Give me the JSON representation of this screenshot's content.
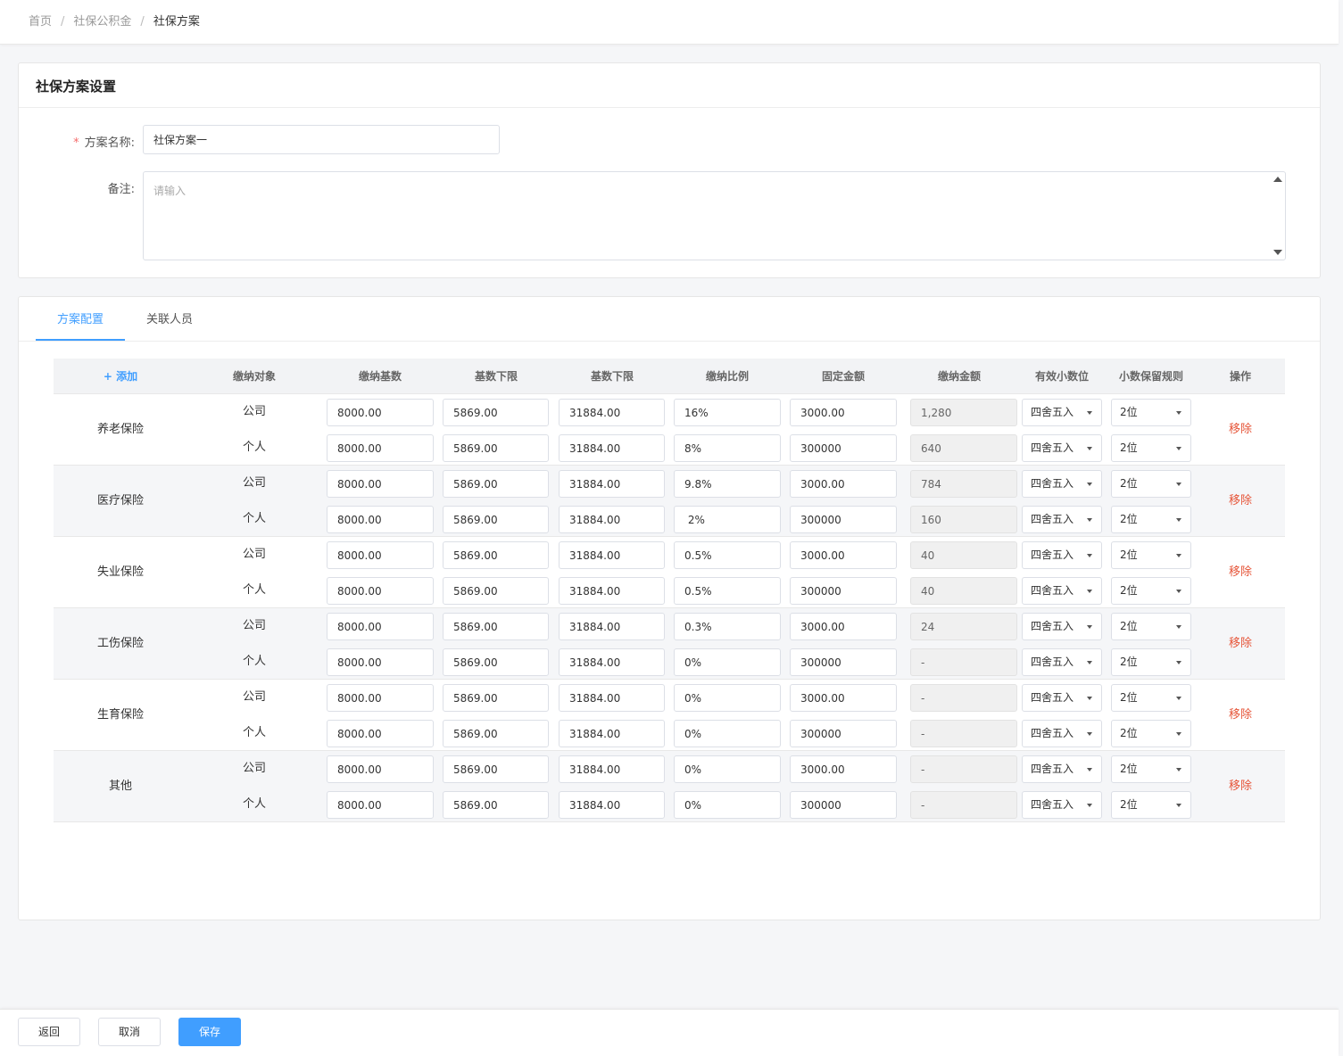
{
  "breadcrumb": {
    "home": "首页",
    "parent": "社保公积金",
    "current": "社保方案",
    "sep": "/"
  },
  "form": {
    "title": "社保方案设置",
    "name_label": "方案名称:",
    "required_mark": "*",
    "name_value": "社保方案一",
    "remark_label": "备注:",
    "remark_placeholder": "请输入"
  },
  "tabs": [
    {
      "label": "方案配置",
      "active": true
    },
    {
      "label": "关联人员",
      "active": false
    }
  ],
  "table": {
    "add_label": "+ 添加",
    "headers": [
      "缴纳对象",
      "缴纳基数",
      "基数下限",
      "基数下限",
      "缴纳比例",
      "固定金额",
      "缴纳金额",
      "有效小数位",
      "小数保留规则",
      "操作"
    ],
    "remove_label": "移除",
    "groups": [
      {
        "name": "养老保险",
        "rows": [
          {
            "target": "公司",
            "base": "8000.00",
            "lower": "5869.00",
            "upper": "31884.00",
            "ratio": "16%",
            "fixed": "3000.00",
            "amount": "1,280",
            "rounding": "四舍五入",
            "decimals": "2位"
          },
          {
            "target": "个人",
            "base": "8000.00",
            "lower": "5869.00",
            "upper": "31884.00",
            "ratio": "8%",
            "fixed": "300000",
            "amount": "640",
            "rounding": "四舍五入",
            "decimals": "2位"
          }
        ]
      },
      {
        "name": "医疗保险",
        "rows": [
          {
            "target": "公司",
            "base": "8000.00",
            "lower": "5869.00",
            "upper": "31884.00",
            "ratio": "9.8%",
            "fixed": "3000.00",
            "amount": "784",
            "rounding": "四舍五入",
            "decimals": "2位"
          },
          {
            "target": "个人",
            "base": "8000.00",
            "lower": "5869.00",
            "upper": "31884.00",
            "ratio": " 2%",
            "fixed": "300000",
            "amount": "160",
            "rounding": "四舍五入",
            "decimals": "2位"
          }
        ]
      },
      {
        "name": "失业保险",
        "rows": [
          {
            "target": "公司",
            "base": "8000.00",
            "lower": "5869.00",
            "upper": "31884.00",
            "ratio": "0.5%",
            "fixed": "3000.00",
            "amount": "40",
            "rounding": "四舍五入",
            "decimals": "2位"
          },
          {
            "target": "个人",
            "base": "8000.00",
            "lower": "5869.00",
            "upper": "31884.00",
            "ratio": "0.5%",
            "fixed": "300000",
            "amount": "40",
            "rounding": "四舍五入",
            "decimals": "2位"
          }
        ]
      },
      {
        "name": "工伤保险",
        "rows": [
          {
            "target": "公司",
            "base": "8000.00",
            "lower": "5869.00",
            "upper": "31884.00",
            "ratio": "0.3%",
            "fixed": "3000.00",
            "amount": "24",
            "rounding": "四舍五入",
            "decimals": "2位"
          },
          {
            "target": "个人",
            "base": "8000.00",
            "lower": "5869.00",
            "upper": "31884.00",
            "ratio": "0%",
            "fixed": "300000",
            "amount": "-",
            "rounding": "四舍五入",
            "decimals": "2位"
          }
        ]
      },
      {
        "name": "生育保险",
        "rows": [
          {
            "target": "公司",
            "base": "8000.00",
            "lower": "5869.00",
            "upper": "31884.00",
            "ratio": "0%",
            "fixed": "3000.00",
            "amount": "-",
            "rounding": "四舍五入",
            "decimals": "2位"
          },
          {
            "target": "个人",
            "base": "8000.00",
            "lower": "5869.00",
            "upper": "31884.00",
            "ratio": "0%",
            "fixed": "300000",
            "amount": "-",
            "rounding": "四舍五入",
            "decimals": "2位"
          }
        ]
      },
      {
        "name": "其他",
        "rows": [
          {
            "target": "公司",
            "base": "8000.00",
            "lower": "5869.00",
            "upper": "31884.00",
            "ratio": "0%",
            "fixed": "3000.00",
            "amount": "-",
            "rounding": "四舍五入",
            "decimals": "2位"
          },
          {
            "target": "个人",
            "base": "8000.00",
            "lower": "5869.00",
            "upper": "31884.00",
            "ratio": "0%",
            "fixed": "300000",
            "amount": "-",
            "rounding": "四舍五入",
            "decimals": "2位"
          }
        ]
      }
    ]
  },
  "footer": {
    "back_label": "返回",
    "cancel_label": "取消",
    "save_label": "保存"
  },
  "colors": {
    "primary": "#409eff",
    "danger": "#e6563a",
    "required": "#f56c6c"
  }
}
